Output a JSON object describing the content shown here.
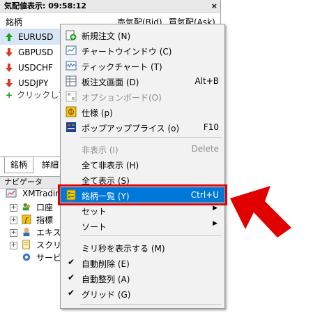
{
  "market_watch": {
    "title": "気配値表示: 09:58:12",
    "close_label": "×",
    "columns": {
      "symbol": "銘柄",
      "bid": "売気配(Bid)",
      "ask": "買気配(Ask)"
    },
    "rows": [
      {
        "symbol": "EURUSD",
        "direction": "up",
        "color": "#22a022"
      },
      {
        "symbol": "GBPUSD",
        "direction": "down",
        "color": "#d83a2a"
      },
      {
        "symbol": "USDCHF",
        "direction": "down",
        "color": "#d83a2a"
      },
      {
        "symbol": "USDJPY",
        "direction": "down",
        "color": "#d83a2a"
      }
    ],
    "add_row": "クリックして追",
    "tabs": [
      "銘柄",
      "詳細"
    ]
  },
  "navigator": {
    "title": "ナビゲータ",
    "root": "XMTradin",
    "items": [
      "口座",
      "指標",
      "エキス",
      "スクリ",
      "サービ"
    ]
  },
  "context_menu": {
    "items": [
      {
        "label": "新規注文 (N)",
        "icon": "new-order-icon",
        "shortcut": ""
      },
      {
        "label": "チャートウインドウ (C)",
        "icon": "chart-window-icon",
        "shortcut": ""
      },
      {
        "label": "ティックチャート (T)",
        "icon": "tick-chart-icon",
        "shortcut": ""
      },
      {
        "label": "板注文画面 (D)",
        "icon": "depth-of-market-icon",
        "shortcut": "Alt+B"
      },
      {
        "label": "オプションボード(O)",
        "icon": "option-board-icon",
        "shortcut": "",
        "disabled": true
      },
      {
        "label": "仕様 (p)",
        "icon": "specification-icon",
        "shortcut": ""
      },
      {
        "label": "ポップアッププライス (o)",
        "icon": "popup-prices-icon",
        "shortcut": "F10"
      },
      {
        "label": "非表示 (I)",
        "shortcut": "Delete",
        "disabled": true
      },
      {
        "label": "全て非表示 (H)",
        "shortcut": ""
      },
      {
        "label": "全て表示 (S)",
        "shortcut": ""
      },
      {
        "label": "銘柄一覧 (Y)",
        "icon": "symbols-icon",
        "shortcut": "Ctrl+U",
        "highlighted": true
      },
      {
        "label": "セット",
        "submenu": true
      },
      {
        "label": "ソート",
        "submenu": true
      },
      {
        "label": "ミリ秒を表示する (M)"
      },
      {
        "label": "自動削除 (E)",
        "checked": true
      },
      {
        "label": "自動整列 (A)",
        "checked": true
      },
      {
        "label": "グリッド (G)",
        "checked": true
      }
    ],
    "submenu_glyph": "▶",
    "check_glyph": "✔"
  },
  "colors": {
    "highlight": "#0078d7",
    "annotation": "#e00000"
  }
}
